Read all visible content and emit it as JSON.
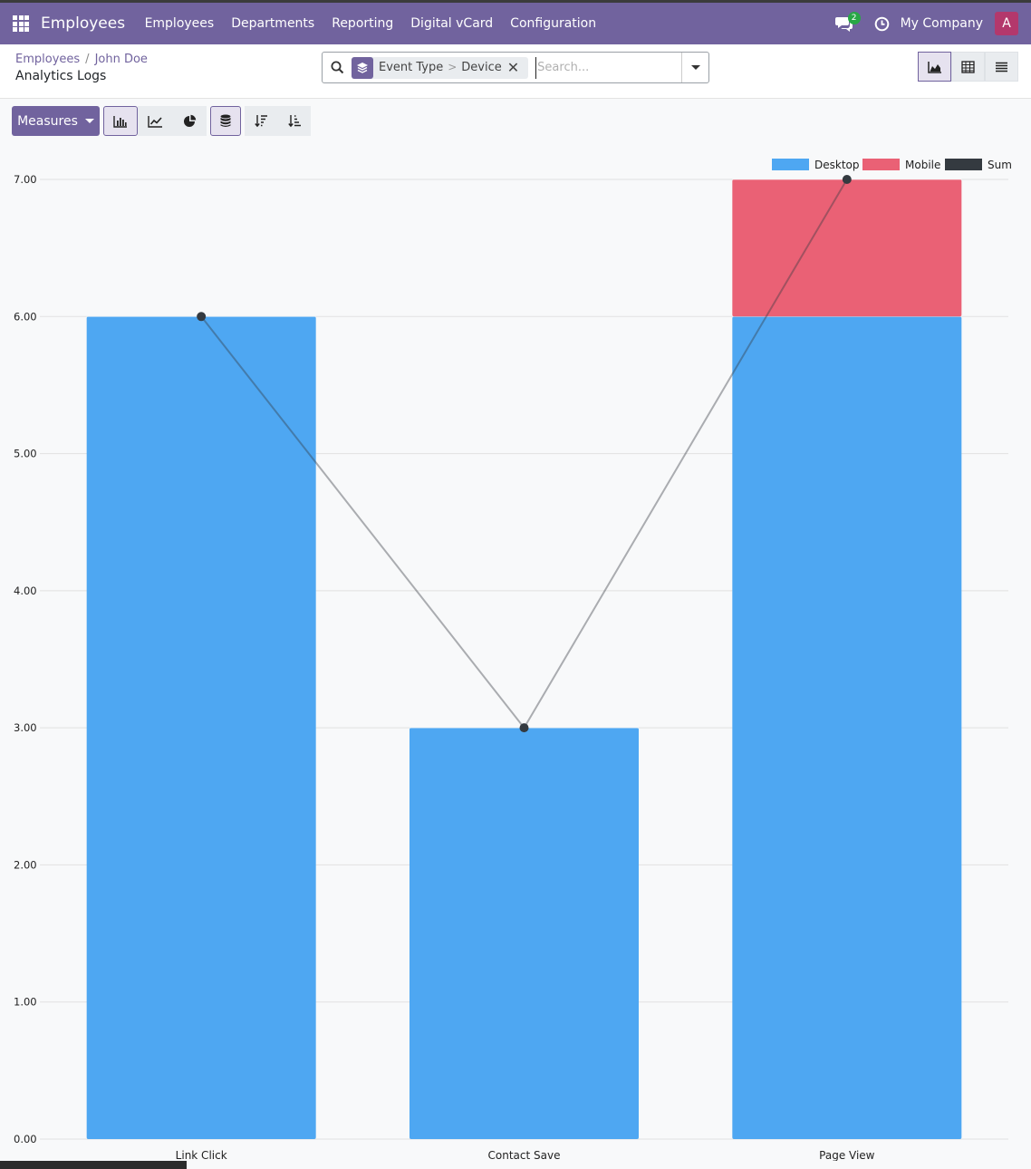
{
  "navbar": {
    "brand": "Employees",
    "menu": [
      "Employees",
      "Departments",
      "Reporting",
      "Digital vCard",
      "Configuration"
    ],
    "messages_count": "2",
    "company": "My Company",
    "avatar_letter": "A",
    "color": "#71639e"
  },
  "breadcrumb": {
    "items": [
      "Employees",
      "John Doe"
    ],
    "current": "Analytics Logs"
  },
  "search": {
    "facet_groups": [
      "Event Type",
      "Device"
    ],
    "placeholder": "Search..."
  },
  "toolbar": {
    "measures_label": "Measures"
  },
  "icons": {
    "apps": "apps-grid-icon",
    "messages": "chat-icon",
    "activity": "clock-icon",
    "search": "search-icon",
    "facet": "layers-icon",
    "remove": "close-icon"
  },
  "chart_data": {
    "type": "bar",
    "stacked": true,
    "categories": [
      "Link Click",
      "Contact Save",
      "Page View"
    ],
    "series": [
      {
        "name": "Desktop",
        "values": [
          6,
          3,
          6
        ],
        "color": "#4ea7f2"
      },
      {
        "name": "Mobile",
        "values": [
          0,
          0,
          1
        ],
        "color": "#ea6175"
      }
    ],
    "line_series": {
      "name": "Sum",
      "values": [
        6,
        3,
        7
      ],
      "color": "#343a40"
    },
    "ylim": [
      0,
      7
    ],
    "yticks": [
      "0.00",
      "1.00",
      "2.00",
      "3.00",
      "4.00",
      "5.00",
      "6.00",
      "7.00"
    ],
    "legend_position": "top-right",
    "grid": true
  }
}
